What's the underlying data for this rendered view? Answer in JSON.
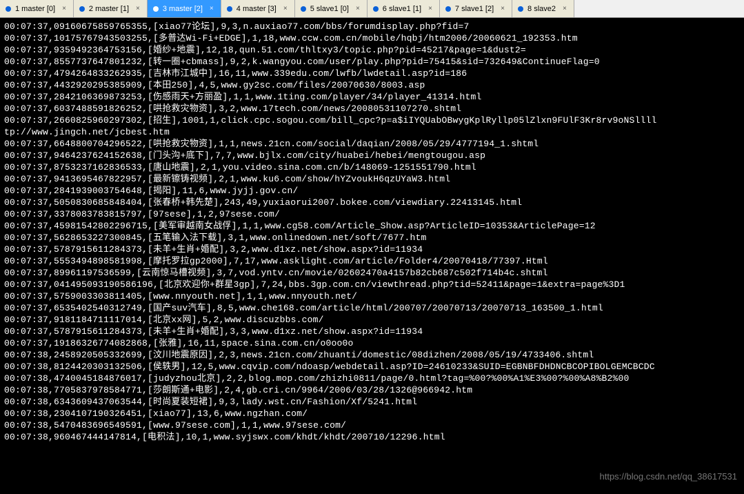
{
  "tabs": [
    {
      "label": "1 master [0]",
      "active": false
    },
    {
      "label": "2 master [1]",
      "active": false
    },
    {
      "label": "3 master [2]",
      "active": true
    },
    {
      "label": "4 master [3]",
      "active": false
    },
    {
      "label": "5 slave1 [0]",
      "active": false
    },
    {
      "label": "6 slave1 [1]",
      "active": false
    },
    {
      "label": "7 slave1 [2]",
      "active": false
    },
    {
      "label": "8 slave2",
      "active": false
    }
  ],
  "close_glyph": "×",
  "watermark": "https://blog.csdn.net/qq_38617531",
  "log_lines": [
    "00:07:37,09160675859765355,[xiao77论坛],9,3,n.auxiao77.com/bbs/forumdisplay.php?fid=7",
    "00:07:37,10175767943503255,[多普达Wi-Fi+EDGE],1,18,www.ccw.com.cn/mobile/hqbj/htm2006/20060621_192353.htm",
    "00:07:37,9359492364753156,[婚纱+地震],12,18,qun.51.com/thltxy3/topic.php?pid=45217&page=1&dust2=",
    "00:07:37,8557737647801232,[转一圈+cbmass],9,2,k.wangyou.com/user/play.php?pid=75415&sid=732649&ContinueFlag=0",
    "00:07:37,4794264833262935,[吉林市江城中],16,11,www.339edu.com/lwfb/lwdetail.asp?id=186",
    "00:07:37,4432920295385909,[本田250],4,5,www.gy2sc.com/files/20070630/8003.asp",
    "00:07:37,2842106369873253,[伤感雨天+方丽盈],1,1,www.1ting.com/player/34/player_41314.html",
    "00:07:37,6037488591826252,[哄抢救灾物资],3,2,www.17tech.com/news/20080531107270.shtml",
    "00:07:37,2660825960297302,[招生],1001,1,click.cpc.sogou.com/bill_cpc?p=a$iIYQUabOBwygKplRyllp05lZlxn9FUlF3Kr8rv9oNSllll",
    "tp://www.jingch.net/jcbest.htm",
    "00:07:37,6648800704296522,[哄抢救灾物资],1,1,news.21cn.com/social/daqian/2008/05/29/4777194_1.shtml",
    "00:07:37,9464237624152638,[门头沟+底下],7,7,www.bjlx.com/city/huabei/hebei/mengtougou.asp",
    "00:07:37,8753237162836533,[唐山地震],2,1,you.video.sina.com.cn/b/148069-1251551790.html",
    "00:07:37,9413695467822957,[最新镲铸视频],2,1,www.ku6.com/show/hYZvoukH6qzUYaW3.html",
    "00:07:37,2841939003754648,[揭阳],11,6,www.jyjj.gov.cn/",
    "00:07:37,5050830685848404,[张春桥+韩先楚],243,49,yuxiaorui2007.bokee.com/viewdiary.22413145.html",
    "00:07:37,3378083783815797,[97sese],1,2,97sese.com/",
    "00:07:37,45981542802296715,[美军审越南女战俘],1,1,www.cg58.com/Article_Show.asp?ArticleID=10353&ArticlePage=12",
    "00:07:37,5628653227300845,[五笔输入法下载],3,1,www.onlinedown.net/soft/7677.htm",
    "00:07:37,5787915611284373,[未羊+生肖+婚配],3,2,www.d1xz.net/show.aspx?id=11934",
    "00:07:37,5553494898581998,[摩托罗拉gp2000],7,17,www.asklight.com/article/Folder4/20070418/77397.Html",
    "00:07:37,89961197536599,[云南惊马槽视频],3,7,vod.yntv.cn/movie/02602470a4157b82cb687c502f714b4c.shtml",
    "00:07:37,041495093190586196,[北京欢迎你+群星3gp],7,24,bbs.3gp.com.cn/viewthread.php?tid=52411&page=1&extra=page%3D1",
    "00:07:37,5759003303811405,[www.nnyouth.net],1,1,www.nnyouth.net/",
    "00:07:37,6535402540312749,[国产suv汽车],8,5,www.che168.com/article/html/200707/20070713/20070713_163500_1.html",
    "00:07:37,9181184711117014,[北京xx网],5,2,www.discuzbbs.com/",
    "00:07:37,5787915611284373,[未羊+生肖+婚配],3,3,www.d1xz.net/show.aspx?id=11934",
    "00:07:37,19186326774082868,[张雅],16,11,space.sina.com.cn/o0oo0o",
    "00:07:38,2458920505332699,[汶川地震原因],2,3,news.21cn.com/zhuanti/domestic/08dizhen/2008/05/19/4733406.shtml",
    "00:07:38,8124420303132506,[侯轶男],12,5,www.cqvip.com/ndoasp/webdetail.asp?ID=24610233&SUID=EGBNBFDHDNCBCOPIBOLGEMCBCDC",
    "00:07:38,4740045184876017,[judyzhou北京],2,2,blog.mop.com/zhizhi0811/page/0.html?tag=%00?%00%A1%E3%00?%00%A8%B2%00",
    "00:07:38,7705837978584771,[莎朗斯通+电影],2,4,gb.cri.cn/9964/2006/03/28/1326@966942.htm",
    "00:07:38,6343609437063544,[时尚夏装短裙],9,3,lady.wst.cn/Fashion/Xf/5241.html",
    "00:07:38,2304107190326451,[xiao77],13,6,www.ngzhan.com/",
    "00:07:38,5470483696549591,[www.97sese.com],1,1,www.97sese.com/",
    "00:07:38,960467444147814,[电积法],10,1,www.syjswx.com/khdt/khdt/200710/12296.html"
  ]
}
